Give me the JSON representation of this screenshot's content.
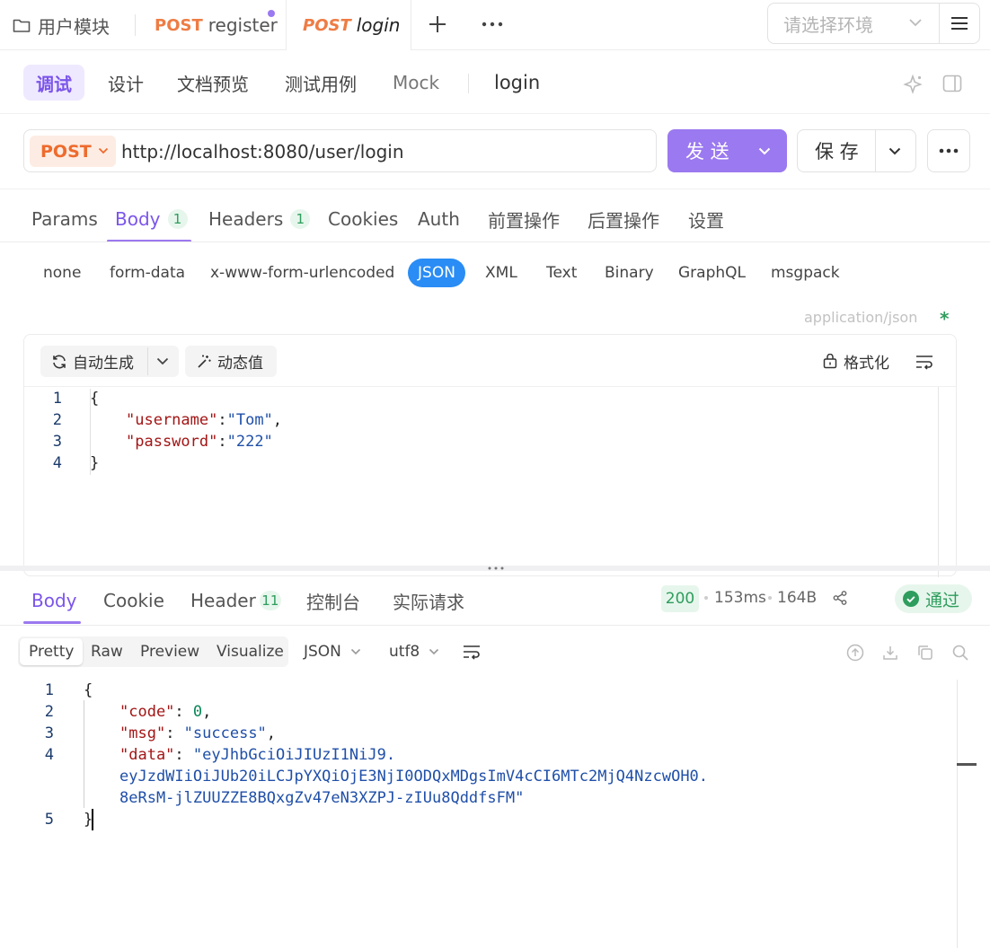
{
  "top_tabs": {
    "folder": {
      "icon": "folder-icon",
      "label": "用户模块"
    },
    "register": {
      "method": "POST",
      "label": "register"
    },
    "login": {
      "method": "POST",
      "label": "login"
    },
    "environment_placeholder": "请选择环境"
  },
  "subnav": {
    "items": [
      "调试",
      "设计",
      "文档预览",
      "测试用例",
      "Mock"
    ],
    "endpoint_name": "login"
  },
  "request": {
    "method": "POST",
    "url": "http://localhost:8080/user/login",
    "send_label": "发 送",
    "save_label": "保 存"
  },
  "request_tabs": [
    {
      "label": "Params"
    },
    {
      "label": "Body",
      "count": "1"
    },
    {
      "label": "Headers",
      "count": "1"
    },
    {
      "label": "Cookies"
    },
    {
      "label": "Auth"
    },
    {
      "label": "前置操作"
    },
    {
      "label": "后置操作"
    },
    {
      "label": "设置"
    }
  ],
  "body_types": [
    "none",
    "form-data",
    "x-www-form-urlencoded",
    "JSON",
    "XML",
    "Text",
    "Binary",
    "GraphQL",
    "msgpack"
  ],
  "content_type": {
    "label": "application/json",
    "required_mark": "*"
  },
  "editor_toolbar": {
    "auto_generate": "自动生成",
    "dynamic_value": "动态值",
    "format": "格式化"
  },
  "request_body": {
    "line_numbers": [
      "1",
      "2",
      "3",
      "4"
    ],
    "open_brace": "{",
    "username_key": "\"username\"",
    "username_value": "\"Tom\"",
    "password_key": "\"password\"",
    "password_value": "\"222\"",
    "close_brace": "}"
  },
  "response_tabs": [
    {
      "label": "Body"
    },
    {
      "label": "Cookie"
    },
    {
      "label": "Header",
      "count": "11"
    },
    {
      "label": "控制台"
    },
    {
      "label": "实际请求"
    }
  ],
  "response_meta": {
    "status": "200",
    "time": "153ms",
    "size": "164B",
    "result": "通过"
  },
  "view_modes": [
    "Pretty",
    "Raw",
    "Preview",
    "Visualize"
  ],
  "format_select": "JSON",
  "encoding_select": "utf8",
  "response_body": {
    "line_numbers": [
      "1",
      "2",
      "3",
      "4",
      "5"
    ],
    "open_brace": "{",
    "code_key": "\"code\"",
    "code_value": "0",
    "msg_key": "\"msg\"",
    "msg_value": "\"success\"",
    "data_key": "\"data\"",
    "data_line1": "\"eyJhbGciOiJIUzI1NiJ9.",
    "data_line2": "eyJzdWIiOiJUb20iLCJpYXQiOjE3NjI0ODQxMDgsImV4cCI6MTc2MjQ4NzcwOH0.",
    "data_line3": "8eRsM-jlZUUZZE8BQxgZv47eN3XZPJ-zIUu8QddfsFM\"",
    "close_brace": "}"
  },
  "colors": {
    "accent": "#9b79f0",
    "method": "#ee7c44",
    "json_active": "#2a8cf5",
    "success": "#2e9d5d"
  }
}
